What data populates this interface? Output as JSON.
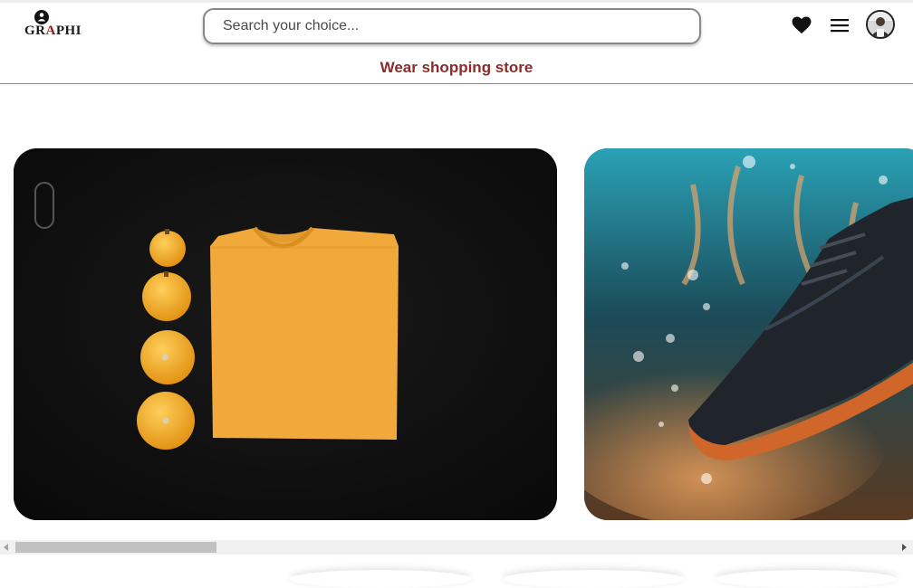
{
  "header": {
    "logo": {
      "text_main": "GR",
      "text_accent": "A",
      "text_end": "PHI",
      "icon": "person-icon"
    },
    "search": {
      "placeholder": "Search your choice...",
      "value": ""
    },
    "icons": {
      "favorites": "heart-icon",
      "menu": "hamburger-menu-icon",
      "profile": "avatar"
    },
    "subtitle": "Wear shopping store"
  },
  "carousel": {
    "items": [
      {
        "subject": "yellow-tshirt-with-pumpkins",
        "background": "#0f0f0f",
        "accent": "#f2a93b"
      },
      {
        "subject": "black-running-shoe-water-splash",
        "background": "#1d4a57",
        "accent": "#d0662a"
      }
    ]
  },
  "colors": {
    "brand": "#8b2c2c",
    "logo_accent": "#8b1a1a",
    "divider": "#8a8a8a"
  }
}
